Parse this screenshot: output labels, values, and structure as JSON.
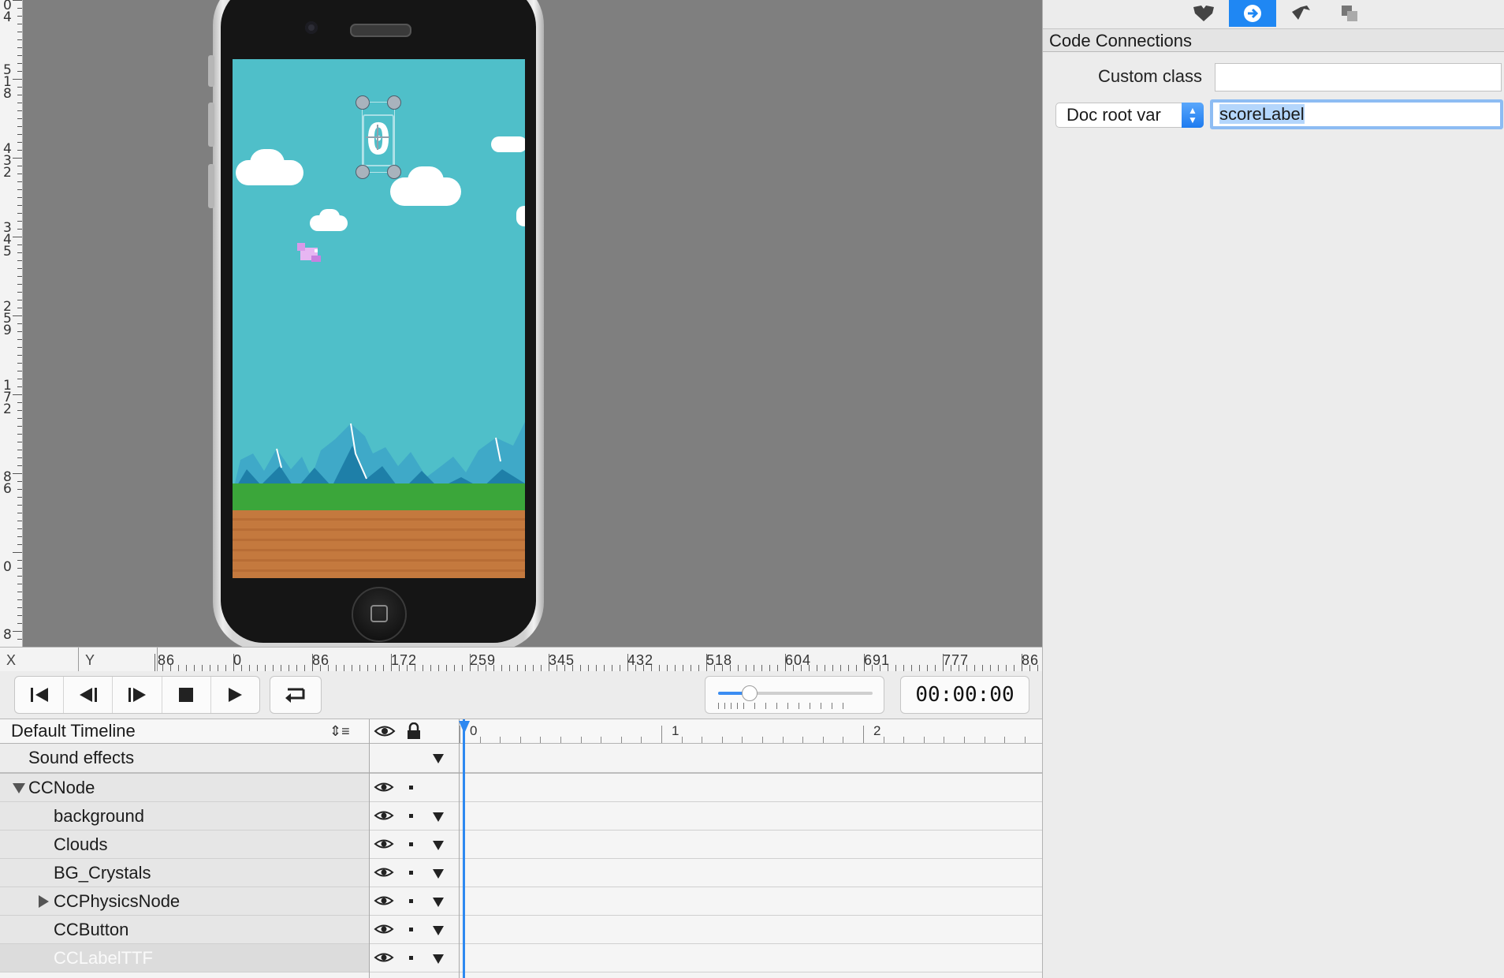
{
  "inspector": {
    "section_title": "Code Connections",
    "custom_class_label": "Custom class",
    "custom_class_value": "",
    "assignment_select": "Doc root var",
    "variable_name": "scoreLabel",
    "tabs": [
      "properties-icon",
      "connections-icon",
      "physics-icon",
      "templates-icon"
    ],
    "active_tab_color": "#1f87f3"
  },
  "canvas": {
    "vertical_ruler_labels": [
      "04",
      "518",
      "432",
      "345",
      "259",
      "172",
      "86",
      "0",
      "8"
    ],
    "horizontal_ruler_labels": [
      "86",
      "0",
      "86",
      "172",
      "259",
      "345",
      "432",
      "518",
      "604",
      "691",
      "777",
      "86"
    ],
    "x_label": "X",
    "y_label": "Y",
    "score_label_text": "0",
    "background_color": "#7f7f7f",
    "sky_color": "#4fbfc9"
  },
  "playback": {
    "time": "00:00:00",
    "zoom_level": 0.2
  },
  "timeline": {
    "name": "Default Timeline",
    "ruler_labels": [
      "0",
      "1",
      "2"
    ],
    "rows": [
      {
        "label": "Sound effects"
      },
      {
        "label": "CCNode"
      },
      {
        "label": "background"
      },
      {
        "label": "Clouds"
      },
      {
        "label": "BG_Crystals"
      },
      {
        "label": "CCPhysicsNode"
      },
      {
        "label": "CCButton"
      },
      {
        "label": "CCLabelTTF"
      }
    ]
  }
}
